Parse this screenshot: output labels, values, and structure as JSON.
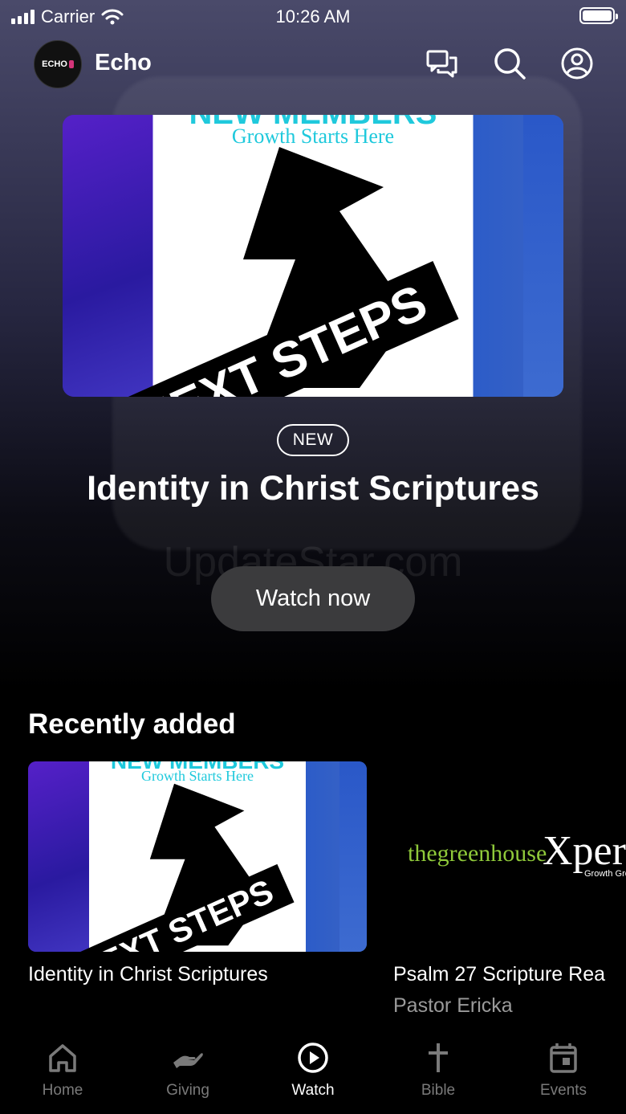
{
  "status_bar": {
    "carrier": "Carrier",
    "time": "10:26 AM"
  },
  "header": {
    "app_name": "Echo",
    "logo_text": "ECHO",
    "icons": [
      "chat-icon",
      "search-icon",
      "profile-icon"
    ]
  },
  "hero": {
    "image_headline": "NEW MEMBERS",
    "image_tagline": "Growth Starts Here",
    "image_banner": "NEXT STEPS",
    "badge": "NEW",
    "title": "Identity in Christ Scriptures",
    "watermark": "UpdateStar.com",
    "cta_label": "Watch now"
  },
  "recently_added": {
    "title": "Recently added",
    "items": [
      {
        "title": "Identity in Christ Scriptures",
        "subtitle": "",
        "image_headline": "NEW MEMBERS",
        "image_tagline": "Growth Starts Here",
        "image_banner": "NEXT STEPS"
      },
      {
        "title": "Psalm 27 Scripture Rea",
        "subtitle": "Pastor Ericka",
        "image_text_green": "thegreenhouse",
        "image_text_white": "Xper",
        "image_text_small": "Growth Gro"
      }
    ]
  },
  "tabbar": {
    "tabs": [
      {
        "label": "Home",
        "icon": "home-icon",
        "active": false
      },
      {
        "label": "Giving",
        "icon": "giving-icon",
        "active": false
      },
      {
        "label": "Watch",
        "icon": "play-icon",
        "active": true
      },
      {
        "label": "Bible",
        "icon": "cross-icon",
        "active": false
      },
      {
        "label": "Events",
        "icon": "calendar-icon",
        "active": false
      }
    ]
  },
  "colors": {
    "accent_cyan": "#1fc9dc",
    "green": "#8fc93a",
    "button_bg": "#3b3b3d",
    "inactive_tab": "#7a7a7a"
  }
}
